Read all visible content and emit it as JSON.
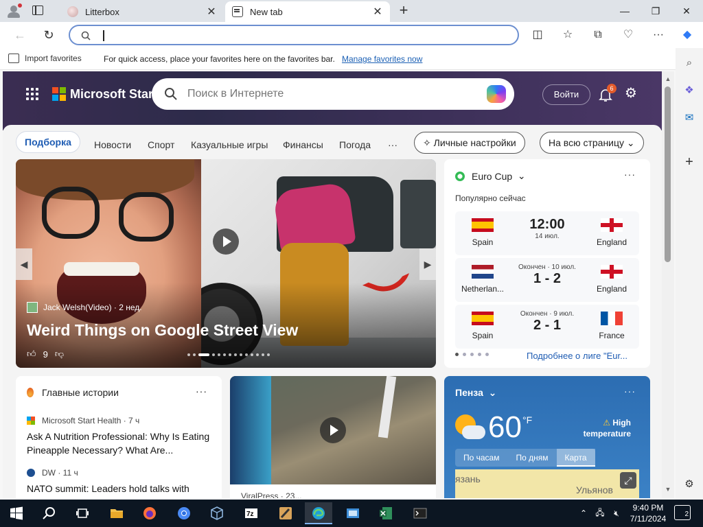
{
  "browser": {
    "tabs": [
      {
        "label": "Litterbox"
      },
      {
        "label": "New tab"
      }
    ],
    "address_placeholder": "",
    "favorites_bar": {
      "import_label": "Import favorites",
      "message": "For quick access, place your favorites here on the favorites bar.",
      "link": "Manage favorites now"
    }
  },
  "start": {
    "brand": "Microsoft Start",
    "search_placeholder": "Поиск в Интернете",
    "login": "Войти",
    "notif_count": "6",
    "nav": [
      "Подборка",
      "Новости",
      "Спорт",
      "Казуальные игры",
      "Финансы",
      "Погода",
      "···"
    ],
    "personalize": "Личные настройки",
    "fullpage": "На всю страницу"
  },
  "hero_card": {
    "source": "Jack Welsh(Video) · 2 нед.",
    "title": "Weird Things on Google Street View",
    "likes": "9"
  },
  "euro": {
    "title": "Euro Cup",
    "subtitle": "Популярно сейчас",
    "matches": [
      {
        "home": "Spain",
        "away": "England",
        "line1": "12:00",
        "line2": "14 июл.",
        "status": ""
      },
      {
        "home": "Netherlan...",
        "away": "England",
        "line1": "1 - 2",
        "line2": "",
        "status": "Окончен · 10 июл."
      },
      {
        "home": "Spain",
        "away": "France",
        "line1": "2 - 1",
        "line2": "",
        "status": "Окончен · 9 июл."
      }
    ],
    "more_link": "Подробнее о лиге \"Eur..."
  },
  "stories": {
    "title": "Главные истории",
    "items": [
      {
        "source": "Microsoft Start Health · 7 ч",
        "title": "Ask A Nutrition Professional: Why Is Eating Pineapple Necessary? What Are..."
      },
      {
        "source": "DW · 11 ч",
        "title": "NATO summit: Leaders hold talks with"
      }
    ]
  },
  "video2": {
    "source": "ViralPress · 23..."
  },
  "weather": {
    "city": "Пенза",
    "temp": "60",
    "unit": "°F",
    "alert": "High temperature",
    "tabs": [
      "По часам",
      "По дням",
      "Карта"
    ],
    "map_labels": [
      "язань",
      "Ульянов"
    ]
  },
  "taskbar": {
    "time": "9:40 PM",
    "date": "7/11/2024",
    "notifications": "2"
  }
}
